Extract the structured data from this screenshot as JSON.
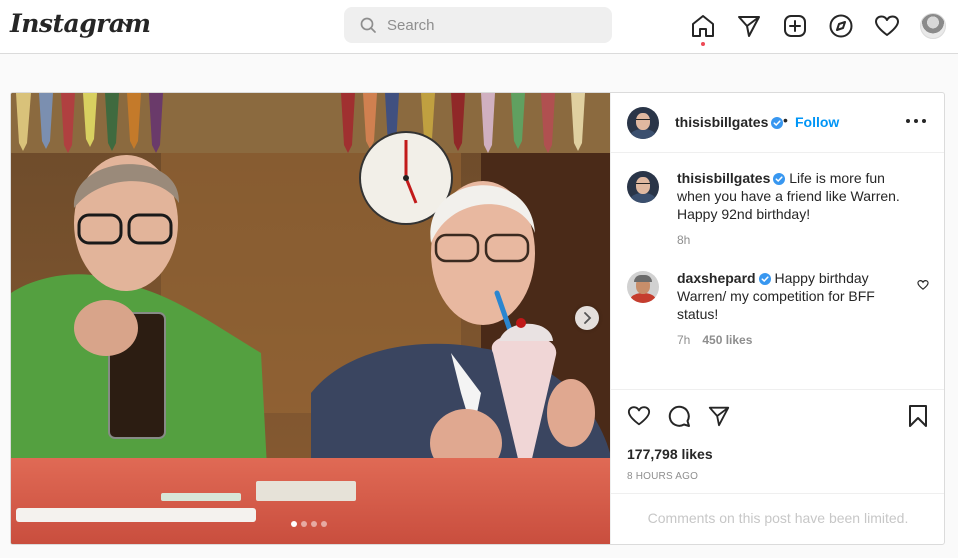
{
  "nav": {
    "logo": "Instagram",
    "search_placeholder": "Search"
  },
  "post": {
    "author": "thisisbillgates",
    "follow_label": "Follow",
    "separator": "•",
    "caption": {
      "username": "thisisbillgates",
      "text": "Life is more fun when you have a friend like Warren. Happy 92nd birthday!",
      "time": "8h"
    },
    "comments": [
      {
        "username": "daxshepard",
        "text": "Happy birthday Warren/ my competition for BFF status!",
        "time": "7h",
        "likes": "450 likes"
      }
    ],
    "likes": "177,798 likes",
    "posted": "8 HOURS AGO",
    "comments_notice": "Comments on this post have been limited.",
    "carousel": {
      "current": 1,
      "total": 4
    }
  },
  "colors": {
    "accent": "#0095f6",
    "verified": "#3897f0",
    "notification": "#ed4956",
    "border": "#dbdbdb"
  },
  "icons": {
    "nav": [
      "home-icon",
      "direct-message-icon",
      "new-post-icon",
      "explore-icon",
      "activity-heart-icon"
    ],
    "actions": [
      "like-heart-icon",
      "comment-icon",
      "share-icon",
      "save-bookmark-icon"
    ]
  }
}
